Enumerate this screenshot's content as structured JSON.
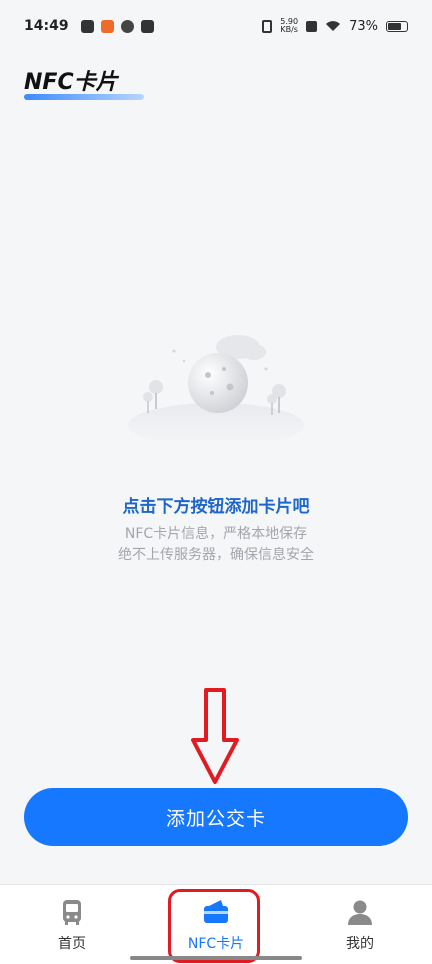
{
  "status_bar": {
    "time": "14:49",
    "net_speed_value": "5.90",
    "net_speed_unit": "KB/s",
    "battery": "73%"
  },
  "header": {
    "title": "NFC卡片"
  },
  "empty_state": {
    "title": "点击下方按钮添加卡片吧",
    "desc_line1": "NFC卡片信息，严格本地保存",
    "desc_line2": "绝不上传服务器，确保信息安全"
  },
  "primary_action": {
    "label": "添加公交卡"
  },
  "bottom_nav": {
    "items": [
      {
        "label": "首页",
        "icon": "bus-icon"
      },
      {
        "label": "NFC卡片",
        "icon": "card-icon"
      },
      {
        "label": "我的",
        "icon": "person-icon"
      }
    ],
    "active_index": 1
  },
  "colors": {
    "accent": "#1677ff",
    "empty_title": "#1e66c9",
    "annotation_red": "#e11b22"
  }
}
